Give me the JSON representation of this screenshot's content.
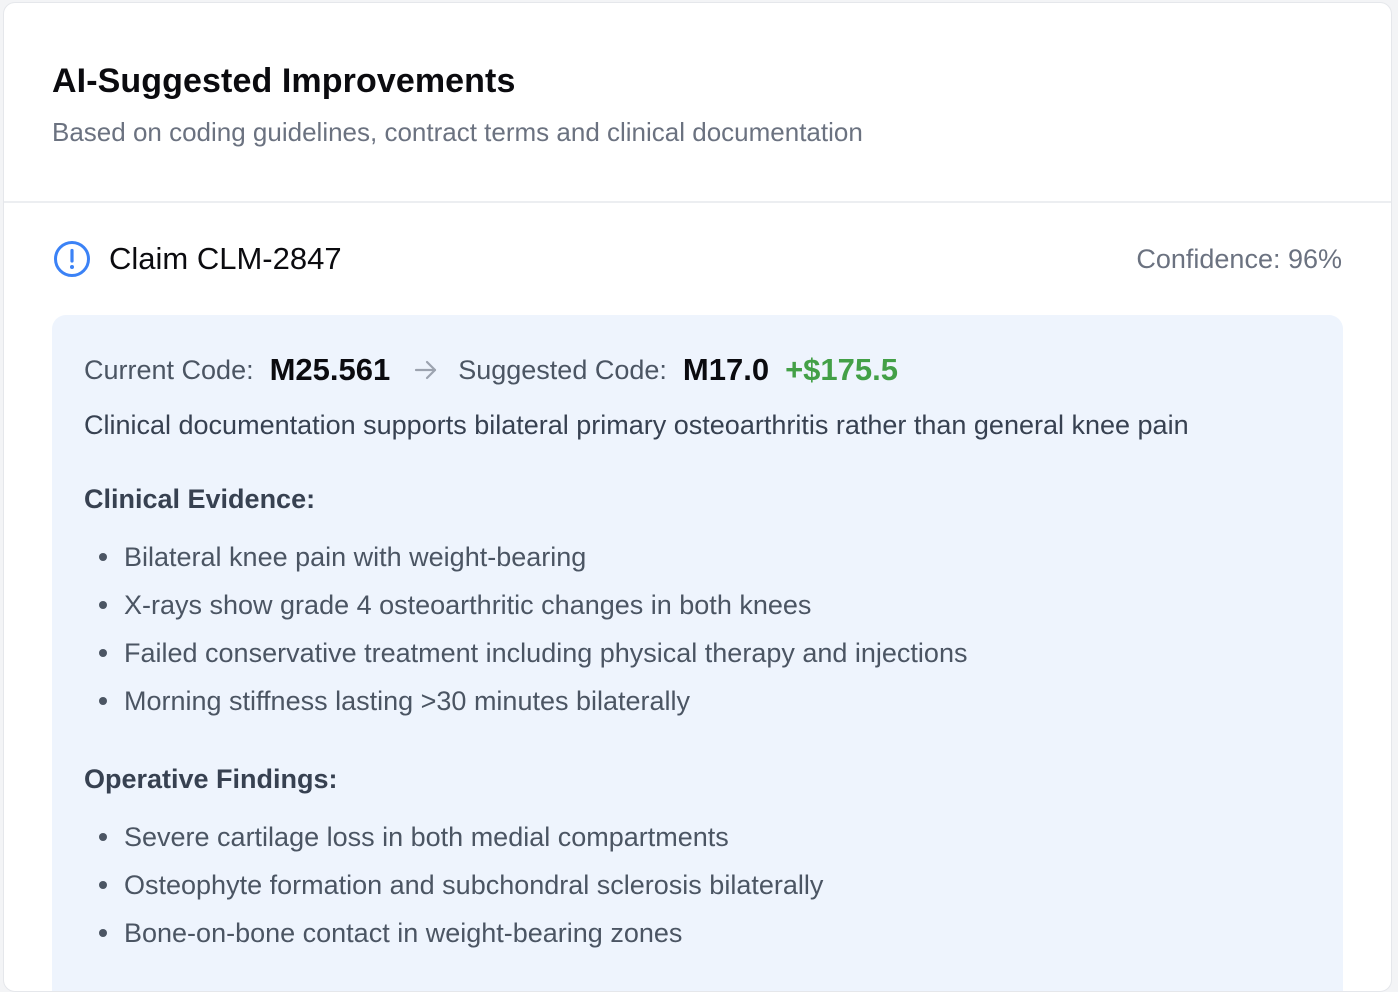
{
  "header": {
    "title": "AI-Suggested Improvements",
    "subtitle": "Based on coding guidelines, contract terms and clinical documentation"
  },
  "claim": {
    "title": "Claim CLM-2847",
    "confidence": "Confidence: 96%",
    "icon": "info-circle-icon",
    "current_code_label": "Current Code:",
    "current_code": "M25.561",
    "suggested_code_label": "Suggested Code:",
    "suggested_code": "M17.0",
    "delta": "+$175.5",
    "rationale": "Clinical documentation supports bilateral primary osteoarthritis rather than general knee pain",
    "clinical_evidence_heading": "Clinical Evidence:",
    "clinical_evidence": [
      "Bilateral knee pain with weight-bearing",
      "X-rays show grade 4 osteoarthritic changes in both knees",
      "Failed conservative treatment including physical therapy and injections",
      "Morning stiffness lasting >30 minutes bilaterally"
    ],
    "operative_findings_heading": "Operative Findings:",
    "operative_findings": [
      "Severe cartilage loss in both medial compartments",
      "Osteophyte formation and subchondral sclerosis bilaterally",
      "Bone-on-bone contact in weight-bearing zones"
    ]
  },
  "colors": {
    "accent_blue": "#3b82f6",
    "positive_green": "#43a047",
    "suggestion_bg": "#eef4fd"
  }
}
